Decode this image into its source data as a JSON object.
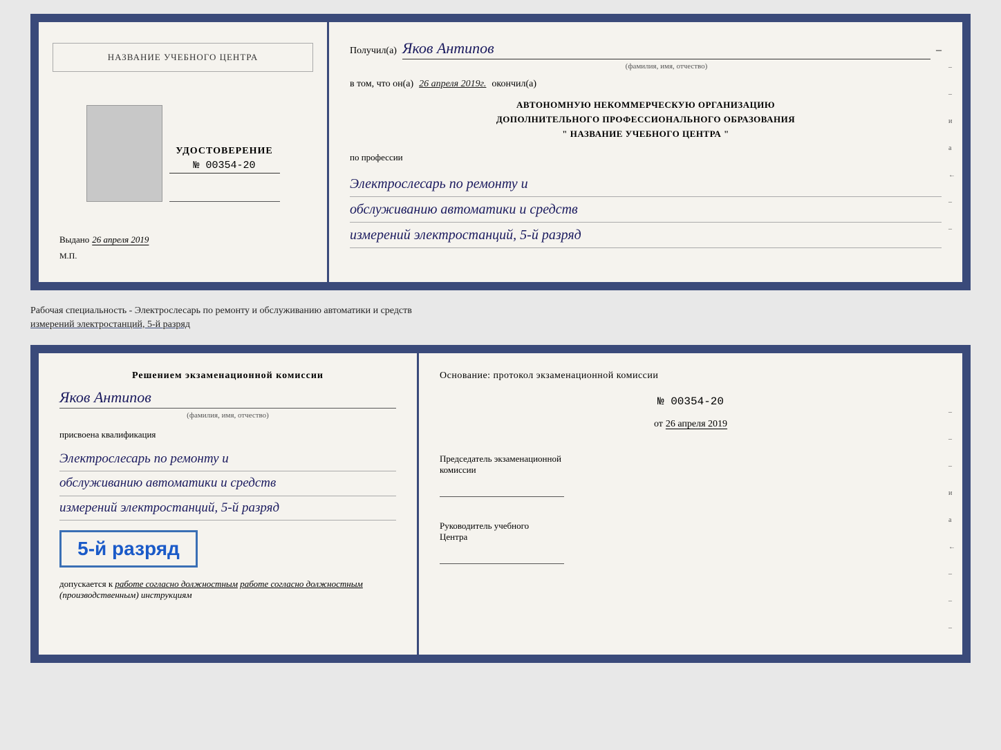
{
  "top_cert": {
    "left": {
      "title": "НАЗВАНИЕ УЧЕБНОГО ЦЕНТРА",
      "photo_alt": "фото",
      "udostoverenie_label": "УДОСТОВЕРЕНИЕ",
      "number": "№ 00354-20",
      "vydano_prefix": "Выдано",
      "vydano_date": "26 апреля 2019",
      "mp": "М.П."
    },
    "right": {
      "poluchil": "Получил(а)",
      "name_handwritten": "Яков Антипов",
      "fio_label": "(фамилия, имя, отчество)",
      "v_tom_prefix": "в том, что он(а)",
      "date_handwritten": "26 апреля 2019г.",
      "okonchil": "окончил(а)",
      "org_line1": "АВТОНОМНУЮ НЕКОММЕРЧЕСКУЮ ОРГАНИЗАЦИЮ",
      "org_line2": "ДОПОЛНИТЕЛЬНОГО ПРОФЕССИОНАЛЬНОГО ОБРАЗОВАНИЯ",
      "org_line3": "\"  НАЗВАНИЕ УЧЕБНОГО ЦЕНТРА  \"",
      "po_professii": "по профессии",
      "profession_line1": "Электрослесарь по ремонту и",
      "profession_line2": "обслуживанию автоматики и средств",
      "profession_line3": "измерений электростанций, 5-й разряд",
      "side_marks": [
        "-",
        "-",
        "и",
        "а",
        "←",
        "-",
        "-",
        "-"
      ]
    }
  },
  "annotation": {
    "text": "Рабочая специальность - Электрослесарь по ремонту и обслуживанию автоматики и средств",
    "text2": "измерений электростанций, 5-й разряд"
  },
  "bottom_cert": {
    "left": {
      "resheniem": "Решением экзаменационной комиссии",
      "name_handwritten": "Яков Антипов",
      "fio_label": "(фамилия, имя, отчество)",
      "prisvoena": "присвоена квалификация",
      "qual_line1": "Электрослесарь по ремонту и",
      "qual_line2": "обслуживанию автоматики и средств",
      "qual_line3": "измерений электростанций, 5-й разряд",
      "razryad_big": "5-й разряд",
      "dopuskaetsya_prefix": "допускается к",
      "dopuskaetsya_italic": "работе согласно должностным",
      "dopuskaetsya_italic2": "(производственным) инструкциям"
    },
    "right": {
      "osnovanie": "Основание: протокол экзаменационной комиссии",
      "number": "№  00354-20",
      "ot_prefix": "от",
      "ot_date": "26 апреля 2019",
      "predsedatel_line1": "Председатель экзаменационной",
      "predsedatel_line2": "комиссии",
      "rukovoditel_line1": "Руководитель учебного",
      "rukovoditel_line2": "Центра",
      "side_marks": [
        "-",
        "-",
        "-",
        "и",
        "а",
        "←",
        "-",
        "-",
        "-",
        "-"
      ]
    }
  }
}
